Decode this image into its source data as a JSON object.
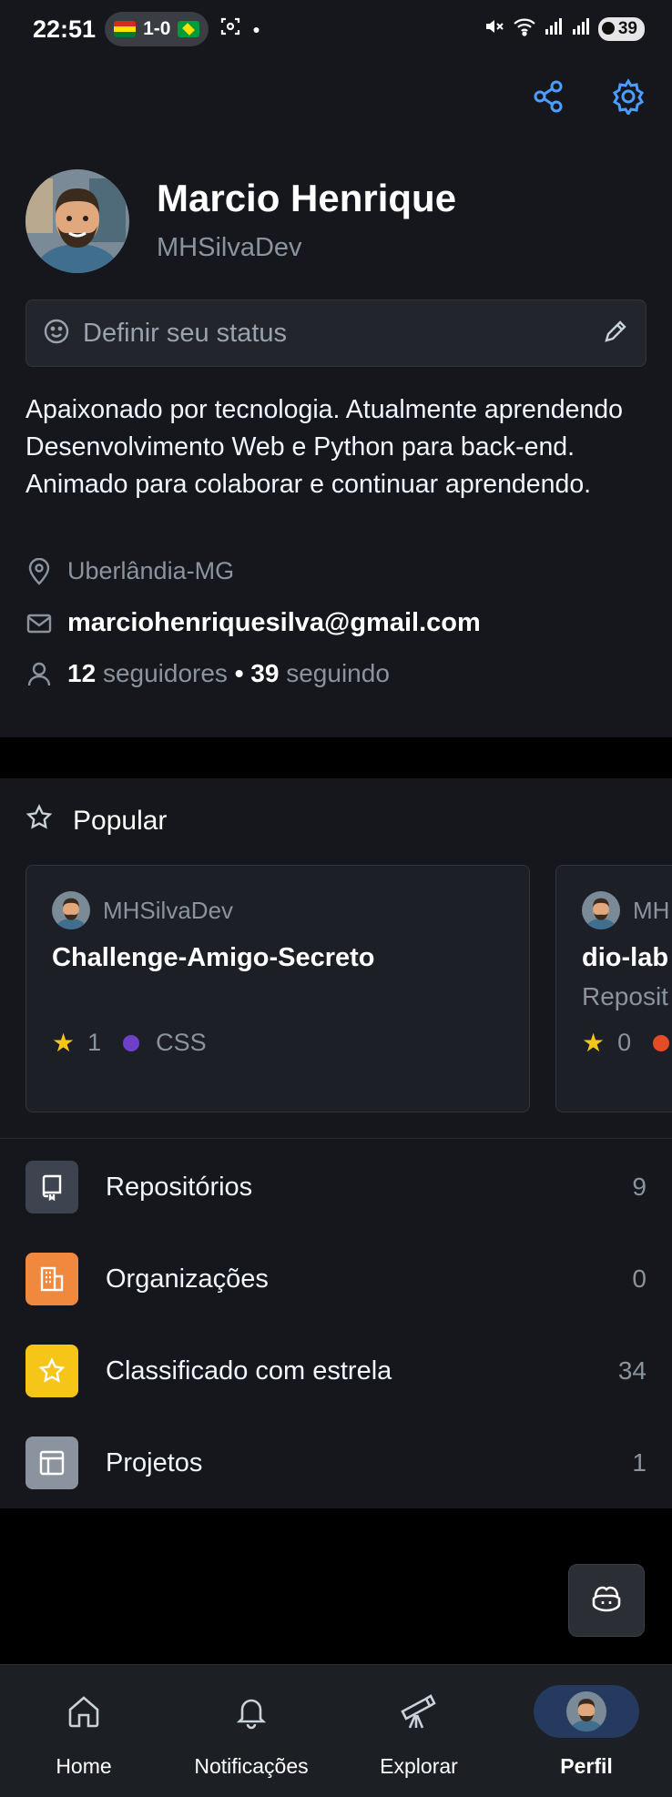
{
  "status_bar": {
    "time": "22:51",
    "score": "1-0",
    "battery": "39"
  },
  "profile": {
    "name": "Marcio Henrique",
    "login": "MHSilvaDev",
    "status_placeholder": "Definir seu status",
    "bio": "Apaixonado por tecnologia. Atualmente aprendendo Desenvolvimento Web e Python para back-end. Animado para colaborar e continuar aprendendo.",
    "location": "Uberlândia-MG",
    "email": "marciohenriquesilva@gmail.com",
    "followers_count": "12",
    "followers_label": "seguidores",
    "separator": "•",
    "following_count": "39",
    "following_label": "seguindo"
  },
  "popular": {
    "title": "Popular",
    "cards": [
      {
        "owner": "MHSilvaDev",
        "name": "Challenge-Amigo-Secreto",
        "description": "",
        "stars": "1",
        "language": "CSS",
        "language_color": "#6e40c9"
      },
      {
        "owner": "MH",
        "name": "dio-lab",
        "description": "Reposit",
        "stars": "0",
        "language": "",
        "language_color": "#e34c26"
      }
    ]
  },
  "menu": [
    {
      "label": "Repositórios",
      "count": "9",
      "icon": "repo-icon",
      "color": "#3d4450"
    },
    {
      "label": "Organizações",
      "count": "0",
      "icon": "organization-icon",
      "color": "#f0883e"
    },
    {
      "label": "Classificado com estrela",
      "count": "34",
      "icon": "star-icon",
      "color": "#f5c518"
    },
    {
      "label": "Projetos",
      "count": "1",
      "icon": "project-icon",
      "color": "#8b949e"
    }
  ],
  "bottom_nav": {
    "items": [
      {
        "label": "Home",
        "icon": "home-icon"
      },
      {
        "label": "Notificações",
        "icon": "bell-icon"
      },
      {
        "label": "Explorar",
        "icon": "telescope-icon"
      },
      {
        "label": "Perfil",
        "icon": "avatar",
        "active": true
      }
    ]
  },
  "colors": {
    "background": "#15171c",
    "accent": "#4a9eff",
    "text_muted": "#8b949e"
  }
}
